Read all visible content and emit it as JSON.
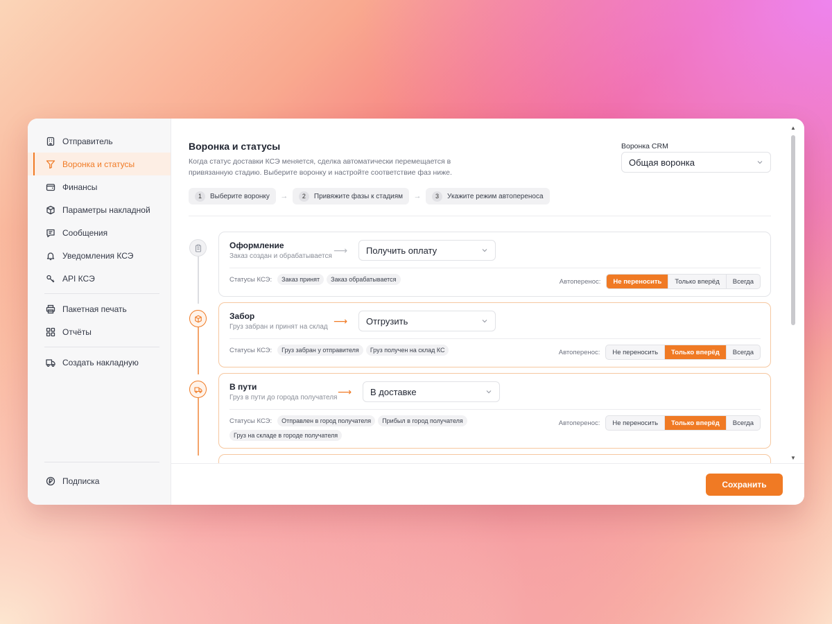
{
  "sidebar": {
    "items": [
      {
        "label": "Отправитель",
        "icon": "building-icon"
      },
      {
        "label": "Воронка и статусы",
        "icon": "filter-icon"
      },
      {
        "label": "Финансы",
        "icon": "wallet-icon"
      },
      {
        "label": "Параметры накладной",
        "icon": "box-icon"
      },
      {
        "label": "Сообщения",
        "icon": "message-icon"
      },
      {
        "label": "Уведомления КСЭ",
        "icon": "bell-icon"
      },
      {
        "label": "API КСЭ",
        "icon": "key-icon"
      },
      {
        "label": "Пакетная печать",
        "icon": "printer-icon"
      },
      {
        "label": "Отчёты",
        "icon": "grid-icon"
      },
      {
        "label": "Создать накладную",
        "icon": "truck-icon"
      }
    ],
    "subscription": "Подписка"
  },
  "header": {
    "title": "Воронка и статусы",
    "description": "Когда статус доставки КСЭ меняется, сделка автоматически перемещается в привязанную стадию. Выберите воронку и настройте соответствие фаз ниже.",
    "funnel_label": "Воронка CRM",
    "funnel_value": "Общая воронка"
  },
  "steps": [
    {
      "num": "1",
      "label": "Выберите воронку"
    },
    {
      "num": "2",
      "label": "Привяжите фазы к стадиям"
    },
    {
      "num": "3",
      "label": "Укажите режим автопереноса"
    }
  ],
  "statuses_label": "Статусы КСЭ:",
  "auto_label": "Автоперенос:",
  "auto_options": [
    "Не переносить",
    "Только вперёд",
    "Всегда"
  ],
  "stages": [
    {
      "name": "Оформление",
      "sub": "Заказ создан и обрабатывается",
      "stage_value": "Получить оплату",
      "tags": [
        "Заказ принят",
        "Заказ обрабатывается"
      ],
      "auto_selected": "Не переносить"
    },
    {
      "name": "Забор",
      "sub": "Груз забран и принят на склад",
      "stage_value": "Отгрузить",
      "tags": [
        "Груз забран у отправителя",
        "Груз получен на склад КС"
      ],
      "auto_selected": "Только вперёд"
    },
    {
      "name": "В пути",
      "sub": "Груз в пути до города получателя",
      "stage_value": "В доставке",
      "tags": [
        "Отправлен в город получателя",
        "Прибыл в город получателя",
        "Груз на складе в городе получателя"
      ],
      "auto_selected": "Только вперёд"
    }
  ],
  "footer": {
    "save_label": "Сохранить"
  },
  "colors": {
    "accent": "#f07a24",
    "accent_light": "#fdeee4"
  }
}
